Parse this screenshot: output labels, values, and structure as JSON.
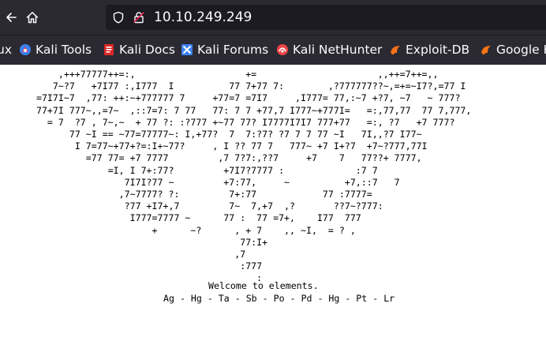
{
  "browser": {
    "url": "10.10.249.249",
    "back_icon": "back-arrow-icon",
    "home_icon": "home-icon",
    "shield_icon": "tracking-protection-shield-icon",
    "lock_icon": "insecure-lock-icon",
    "bookmarks": [
      {
        "label": "ux",
        "icon": "none"
      },
      {
        "label": "Kali Tools",
        "icon": "kali-tools-icon"
      },
      {
        "label": "Kali Docs",
        "icon": "kali-docs-icon"
      },
      {
        "label": "Kali Forums",
        "icon": "kali-forums-icon"
      },
      {
        "label": "Kali NetHunter",
        "icon": "kali-nethunter-icon"
      },
      {
        "label": "Exploit-DB",
        "icon": "exploit-db-icon"
      },
      {
        "label": "Google H",
        "icon": "google-hacking-db-icon"
      }
    ]
  },
  "page": {
    "ascii_art": "      ,+++77777++=:,                    +=                      ,,++=7++=,,\n     7~?7   +7I77 :,I777  I          77 7+77 7:        ,?777777??~,=+=~I7?,=77 I\n  =7I7I~7  ,77: ++:~+777777 7     +77=7 =7I7     ,I777= 77,:~7 +?7, ~7   ~ 777?\n  77+7I 777~,,=7~  ,::7=7: 7 77   77: 7 7 +77,7 I777~+777I=   =:,77,77  77 7,777,\n    = 7  ?7 , 7~,~  + 77 ?: :?777 +~77 77? I7777I7I7 777+77   =:, ?7   +7 777?\n        77 ~I == ~77=77777~: I,+77?  7  7:?7? ?7 7 7 77 ~I   7I,,?7 I77~\n         I 7=77~+77+?=:I+~77?     , I ?? 77 7   777~ +7 I+?7  +7~?777,77I\n           =77 77= +7 7777         ,7 7?7:,??7     +7    7   77??+ 7777,\n               =I, I 7+:77?         +7I7?7777 :             :7 7\n                  7I7I?77 ~         +7:77,     ~          +7,::7   7\n                 ,7~7777? ?:         7+:77            77 :7777=\n                  ?77 +I7+,7         7~  7,+7  ,?       ??7~?777:\n                   I777=7777 ~      77 :  77 =7+,    I77  777\n                       +      ~?      , + 7    ,, ~I,  = ? ,\n                                       77:I+\n                                      ,7\n                                       :777\n                                          :",
    "welcome": "Welcome to elements.",
    "elements_line": "Ag - Hg - Ta - Sb - Po - Pd - Hg - Pt - Lr"
  }
}
